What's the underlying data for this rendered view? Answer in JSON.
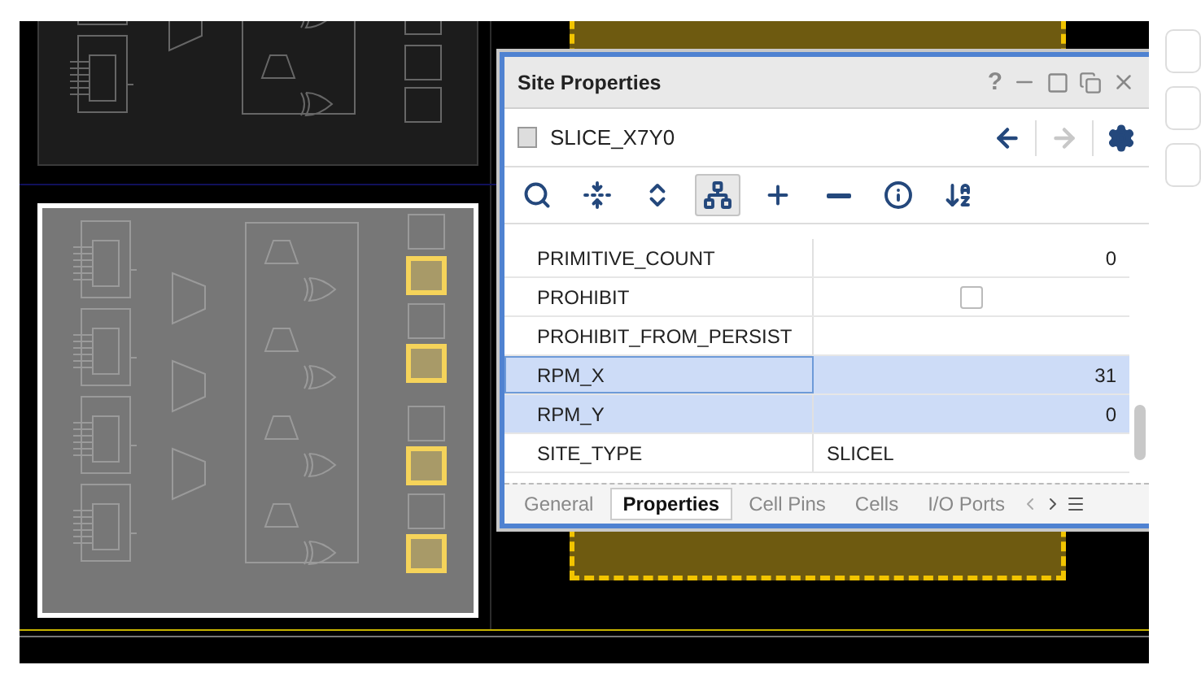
{
  "slices": [
    {
      "selected": false
    },
    {
      "selected": true,
      "flip_flops": [
        {
          "used": false
        },
        {
          "used": true
        },
        {
          "used": false
        },
        {
          "used": true
        },
        {
          "used": false
        },
        {
          "used": true
        },
        {
          "used": false
        },
        {
          "used": true
        }
      ]
    }
  ],
  "window": {
    "title": "Site Properties",
    "help": "?"
  },
  "header": {
    "name": "SLICE_X7Y0",
    "nav": [
      {
        "kind": "back",
        "disabled": false
      },
      {
        "kind": "forward",
        "disabled": true
      }
    ]
  },
  "toolbar": [
    {
      "kind": "search",
      "selected": false
    },
    {
      "kind": "collapse",
      "selected": false
    },
    {
      "kind": "expand",
      "selected": false
    },
    {
      "kind": "tree",
      "selected": true
    },
    {
      "kind": "add",
      "selected": false
    },
    {
      "kind": "remove",
      "selected": false
    },
    {
      "kind": "info",
      "selected": false
    },
    {
      "kind": "sort",
      "selected": false
    }
  ],
  "properties": [
    {
      "name": "PRIMITIVE_COUNT",
      "kind": "number",
      "value": "0",
      "selected": false
    },
    {
      "name": "PROHIBIT",
      "kind": "checkbox",
      "checked": false,
      "selected": false
    },
    {
      "name": "PROHIBIT_FROM_PERSIST",
      "kind": "text",
      "selected": false
    },
    {
      "name": "RPM_X",
      "kind": "number",
      "value": "31",
      "selected": true
    },
    {
      "name": "RPM_Y",
      "kind": "number",
      "value": "0",
      "selected": true
    },
    {
      "name": "SITE_TYPE",
      "kind": "text",
      "value": "SLICEL",
      "selected": false
    }
  ],
  "tabs": [
    {
      "label": "General",
      "selected": false
    },
    {
      "label": "Properties",
      "selected": true
    },
    {
      "label": "Cell Pins",
      "selected": false
    },
    {
      "label": "Cells",
      "selected": false
    },
    {
      "label": "I/O Ports",
      "selected": false
    }
  ]
}
